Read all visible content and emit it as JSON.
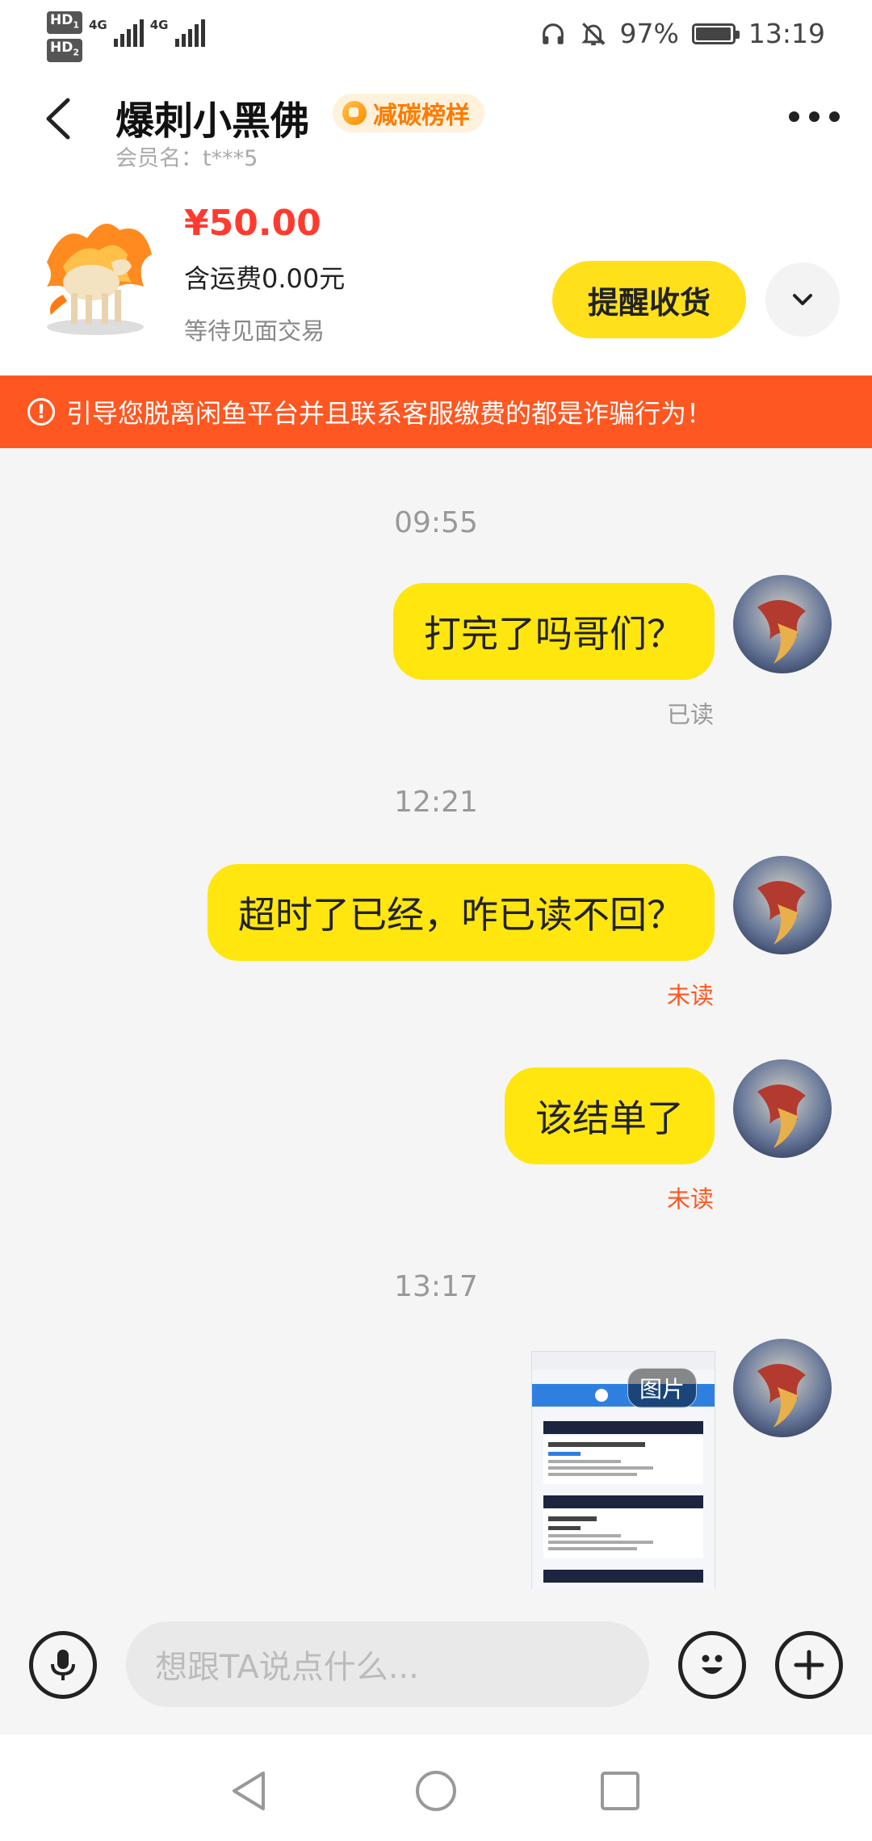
{
  "status_bar": {
    "sim1": "HD",
    "sim1_num": "1",
    "sim2": "HD",
    "sim2_num": "2",
    "net1": "4G",
    "net2": "4G",
    "battery_percent": "97%",
    "battery_level": 0.97,
    "time": "13:19"
  },
  "header": {
    "title": "爆刺小黑佛",
    "badge": "减碳榜样",
    "member": "会员名：t***5"
  },
  "product": {
    "price": "¥50.00",
    "shipping": "含运费0.00元",
    "status": "等待见面交易",
    "action_label": "提醒收货"
  },
  "warning": {
    "text": "引导您脱离闲鱼平台并且联系客服缴费的都是诈骗行为！"
  },
  "chat": {
    "ts1": "09:55",
    "msg1": "打完了吗哥们？",
    "status1": "已读",
    "ts2": "12:21",
    "msg2": "超时了已经，咋已读不回？",
    "status2": "未读",
    "msg3": "该结单了",
    "status3": "未读",
    "ts3": "13:17",
    "image_tag": "图片"
  },
  "input": {
    "placeholder": "想跟TA说点什么..."
  },
  "icons": {
    "back": "chevron-left-icon",
    "more": "more-icon",
    "expand": "chevron-down-icon",
    "voice": "microphone-icon",
    "emoji": "emoji-icon",
    "plus": "plus-icon"
  },
  "colors": {
    "accent": "#ffe60f",
    "price": "#ff3b30",
    "warning": "#ff5722"
  }
}
